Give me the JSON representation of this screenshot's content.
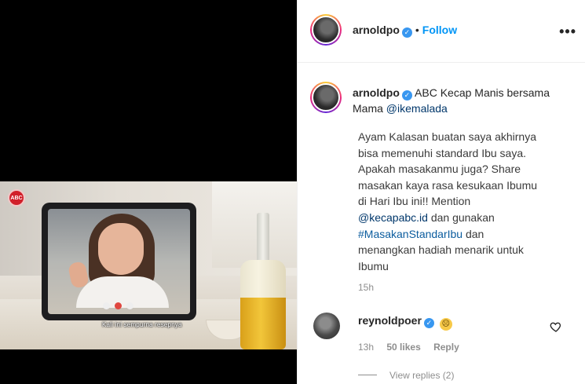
{
  "video": {
    "logo_text": "ABC",
    "subtitle": "Kali ini sempurna resepnya"
  },
  "header": {
    "username": "arnoldpo",
    "separator": "•",
    "follow_label": "Follow",
    "more_icon": "more-horizontal-icon"
  },
  "caption": {
    "username": "arnoldpo",
    "headline": "ABC Kecap Manis bersama Mama",
    "mention_mama": "@ikemalada",
    "body_lines": [
      "Ayam Kalasan buatan saya akhirnya",
      "bisa memenuhi standard Ibu saya.",
      "Apakah masakanmu juga? Share",
      "masakan kaya rasa kesukaan Ibumu",
      "di Hari Ibu ini!! Mention"
    ],
    "mention_brand": "@kecapabc.id",
    "mention_suffix": "dan gunakan",
    "hashtag": "#MasakanStandarIbu",
    "hashtag_suffix": "dan",
    "closing_lines": [
      "menangkan hadiah menarik untuk",
      "Ibumu"
    ],
    "time": "15h"
  },
  "comment": {
    "username": "reynoldpoer",
    "emoji": "😭",
    "time": "13h",
    "likes": "50 likes",
    "reply_label": "Reply",
    "view_replies": "View replies (2)"
  },
  "colors": {
    "link_blue": "#0095f6",
    "verified_blue": "#3897f0",
    "muted_text": "#8e8e8e"
  }
}
